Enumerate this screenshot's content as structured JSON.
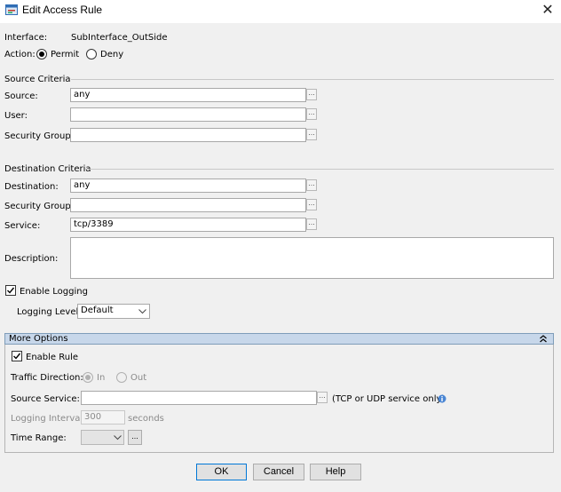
{
  "window": {
    "title": "Edit Access Rule",
    "close_glyph": "✕"
  },
  "interface": {
    "label": "Interface:",
    "value": "SubInterface_OutSide"
  },
  "action": {
    "label": "Action:",
    "permit": "Permit",
    "deny": "Deny",
    "selected": "Permit"
  },
  "source_criteria": {
    "heading": "Source Criteria",
    "source_label": "Source:",
    "source_value": "any",
    "user_label": "User:",
    "user_value": "",
    "security_group_label": "Security Group:",
    "security_group_value": ""
  },
  "destination_criteria": {
    "heading": "Destination Criteria",
    "destination_label": "Destination:",
    "destination_value": "any",
    "security_group_label": "Security Group:",
    "security_group_value": "",
    "service_label": "Service:",
    "service_value": "tcp/3389"
  },
  "description": {
    "label": "Description:",
    "value": ""
  },
  "logging": {
    "enable_label": "Enable Logging",
    "enabled": true,
    "level_label": "Logging Level:",
    "level_value": "Default"
  },
  "more_options": {
    "header": "More Options",
    "enable_rule_label": "Enable Rule",
    "enable_rule_checked": true,
    "traffic_direction_label": "Traffic Direction:",
    "in_label": "In",
    "out_label": "Out",
    "source_service_label": "Source Service:",
    "source_service_value": "",
    "source_service_hint": "(TCP or UDP service only)",
    "logging_interval_label": "Logging Interval:",
    "logging_interval_value": "300",
    "logging_interval_unit": "seconds",
    "time_range_label": "Time Range:",
    "time_range_value": "",
    "time_range_browse": "..."
  },
  "dots_label": "...",
  "buttons": {
    "ok": "OK",
    "cancel": "Cancel",
    "help": "Help"
  },
  "colors": {
    "accent": "#0078d7",
    "more_options_bg": "#c7d7ea",
    "info_icon": "#4a86d4"
  },
  "icons": {
    "app": "app-window-icon",
    "info": "info-icon",
    "chevron_down": "chevron-down-icon",
    "collapse": "double-chevron-up-icon",
    "checkmark": "checkmark-icon"
  }
}
